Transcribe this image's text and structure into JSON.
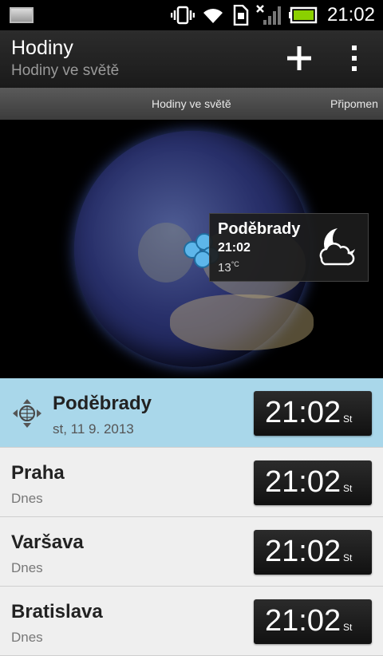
{
  "status_bar": {
    "time": "21:02",
    "icons": [
      "gallery-icon",
      "vibrate-icon",
      "wifi-icon",
      "sd-card-icon",
      "no-signal-icon",
      "battery-charging-icon"
    ]
  },
  "action_bar": {
    "title": "Hodiny",
    "subtitle": "Hodiny ve světě",
    "add_icon": "plus-icon",
    "menu_icon": "overflow-menu-icon"
  },
  "tabs": [
    {
      "label": "Hodiny ve světě"
    },
    {
      "label": "Připomen"
    }
  ],
  "globe_popup": {
    "city": "Poděbrady",
    "time": "21:02",
    "temperature": "13",
    "unit": "°C",
    "weather_icon": "partly-cloudy-night-icon"
  },
  "list": [
    {
      "name": "Poděbrady",
      "sub": "st, 11 9. 2013",
      "time": "21:02",
      "day": "St",
      "selected": true,
      "icon": "location-crosshair-icon"
    },
    {
      "name": "Praha",
      "sub": "Dnes",
      "time": "21:02",
      "day": "St"
    },
    {
      "name": "Varšava",
      "sub": "Dnes",
      "time": "21:02",
      "day": "St"
    },
    {
      "name": "Bratislava",
      "sub": "Dnes",
      "time": "21:02",
      "day": "St"
    }
  ],
  "colors": {
    "selected_row": "#a9d7ea",
    "marker": "#5db6ea",
    "clock_bg": "#1c1c1c"
  }
}
